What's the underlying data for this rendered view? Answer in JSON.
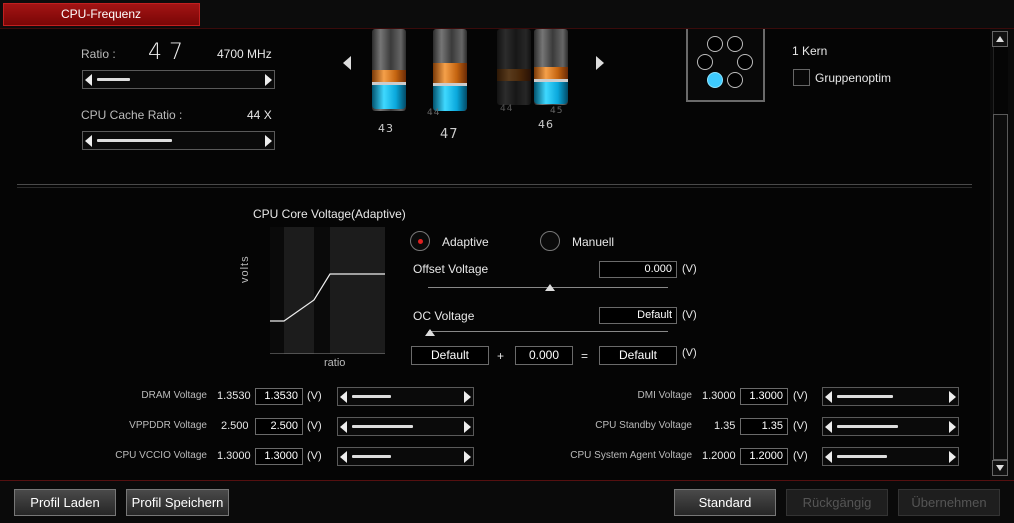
{
  "tabs": [
    {
      "label": "CPU-Frequenz"
    }
  ],
  "ratio": {
    "label": "Ratio :",
    "value": "47",
    "mhz": "4700",
    "mhz_unit": "MHz",
    "slider_level": 0.2
  },
  "cache": {
    "label": "CPU Cache Ratio :",
    "value": "44",
    "unit": "X",
    "slider_level": 0.45
  },
  "cylinders": [
    {
      "label": "43",
      "sub": ""
    },
    {
      "label": "47",
      "sub": "44"
    },
    {
      "label": "",
      "sub": "44"
    },
    {
      "label": "46",
      "sub": "45"
    }
  ],
  "core": {
    "label": "1 Kern",
    "group_label": "Gruppenoptim",
    "active_core": 5
  },
  "voltage": {
    "title": "CPU Core Voltage(Adaptive)",
    "graph_ylabel": "volts",
    "graph_xlabel": "ratio",
    "mode_adaptive": "Adaptive",
    "mode_manual": "Manuell",
    "selected_mode": "Adaptive",
    "offset_label": "Offset Voltage",
    "offset_value": "0.000",
    "offset_unit": "(V)",
    "oc_label": "OC Voltage",
    "oc_value": "Default",
    "oc_unit": "(V)",
    "sum_a": "Default",
    "sum_plus": "+",
    "sum_b": "0.000",
    "sum_eq": "=",
    "sum_result": "Default",
    "sum_unit": "(V)"
  },
  "left_voltages": [
    {
      "label": "DRAM Voltage",
      "current": "1.3530",
      "value": "1.3530",
      "unit": "(V)",
      "slider_level": 0.35
    },
    {
      "label": "VPPDDR Voltage",
      "current": "2.500",
      "value": "2.500",
      "unit": "(V)",
      "slider_level": 0.55
    },
    {
      "label": "CPU VCCIO Voltage",
      "current": "1.3000",
      "value": "1.3000",
      "unit": "(V)",
      "slider_level": 0.35
    }
  ],
  "right_voltages": [
    {
      "label": "DMI Voltage",
      "current": "1.3000",
      "value": "1.3000",
      "unit": "(V)",
      "slider_level": 0.5
    },
    {
      "label": "CPU Standby Voltage",
      "current": "1.35",
      "value": "1.35",
      "unit": "(V)",
      "slider_level": 0.55
    },
    {
      "label": "CPU System Agent Voltage",
      "current": "1.2000",
      "value": "1.2000",
      "unit": "(V)",
      "slider_level": 0.45
    }
  ],
  "buttons": {
    "load": "Profil Laden",
    "save": "Profil Speichern",
    "default": "Standard",
    "undo": "Rückgängig",
    "apply": "Übernehmen"
  },
  "colors": {
    "accent": "#a21414",
    "active_core": "#3ecbff",
    "radio_dot": "#e02020"
  }
}
